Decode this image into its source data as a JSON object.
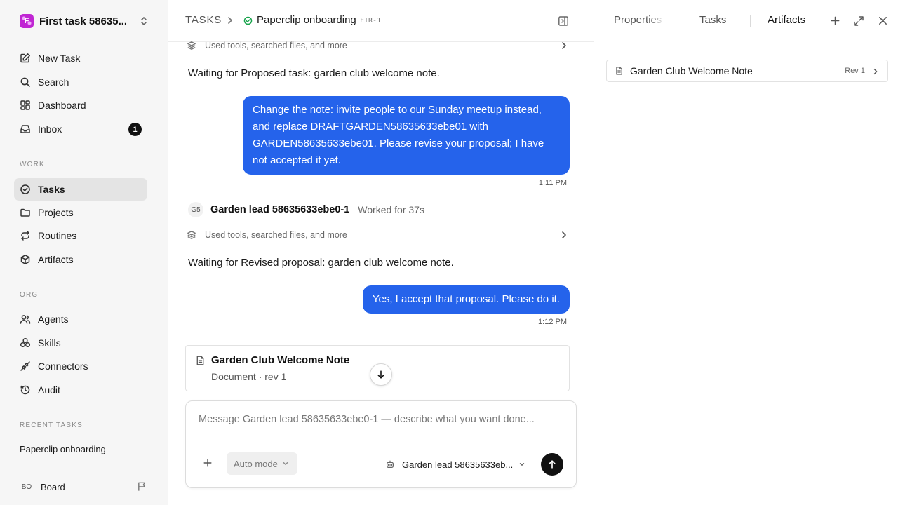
{
  "workspace": {
    "name": "First task 58635...",
    "logo_letter": "F"
  },
  "nav_primary": [
    {
      "label": "New Task",
      "icon": "edit-icon"
    },
    {
      "label": "Search",
      "icon": "search-icon"
    },
    {
      "label": "Dashboard",
      "icon": "dashboard-icon"
    },
    {
      "label": "Inbox",
      "icon": "inbox-icon",
      "badge": "1"
    }
  ],
  "sections": {
    "work": "WORK",
    "org": "ORG",
    "recent": "RECENT TASKS"
  },
  "nav_work": [
    {
      "label": "Tasks",
      "icon": "tasks-icon",
      "active": true
    },
    {
      "label": "Projects",
      "icon": "folder-icon"
    },
    {
      "label": "Routines",
      "icon": "repeat-icon"
    },
    {
      "label": "Artifacts",
      "icon": "box-icon"
    }
  ],
  "nav_org": [
    {
      "label": "Agents",
      "icon": "users-icon"
    },
    {
      "label": "Skills",
      "icon": "skills-icon"
    },
    {
      "label": "Connectors",
      "icon": "plug-icon"
    },
    {
      "label": "Audit",
      "icon": "history-icon"
    }
  ],
  "recent_tasks": [
    "Paperclip onboarding"
  ],
  "board": {
    "initials": "BO",
    "name": "Board"
  },
  "breadcrumb": {
    "root": "TASKS",
    "title": "Paperclip onboarding",
    "id": "FIR-1"
  },
  "conversation": {
    "tools_summary_1": "Used tools, searched files, and more",
    "waiting_1": "Waiting for Proposed task: garden club welcome note.",
    "user_msg_1": "Change the note: invite people to our Sunday meetup instead, and replace DRAFTGARDEN58635633ebe01 with GARDEN58635633ebe01. Please revise your proposal; I have not accepted it yet.",
    "time_1": "1:11 PM",
    "agent_initials": "G5",
    "agent_name": "Garden lead 58635633ebe0-1",
    "agent_worked": "Worked for 37s",
    "tools_summary_2": "Used tools, searched files, and more",
    "waiting_2": "Waiting for Revised proposal: garden club welcome note.",
    "user_msg_2": "Yes, I accept that proposal. Please do it.",
    "time_2": "1:12 PM"
  },
  "doc_card": {
    "title": "Garden Club Welcome Note",
    "subtitle": "Document · rev 1"
  },
  "composer": {
    "placeholder": "Message Garden lead 58635633ebe0-1 — describe what you want done...",
    "value": "",
    "mode": "Auto mode",
    "agent": "Garden lead 58635633eb..."
  },
  "right_panel": {
    "tabs": [
      "Properties",
      "Tasks",
      "Artifacts"
    ],
    "active_tab": "Artifacts",
    "artifacts": [
      {
        "title": "Garden Club Welcome Note",
        "rev": "Rev 1"
      }
    ]
  },
  "colors": {
    "accent": "#2563eb",
    "active_nav": "#e4e4e4",
    "status_done": "#16a34a",
    "logo": "#c026d3"
  }
}
